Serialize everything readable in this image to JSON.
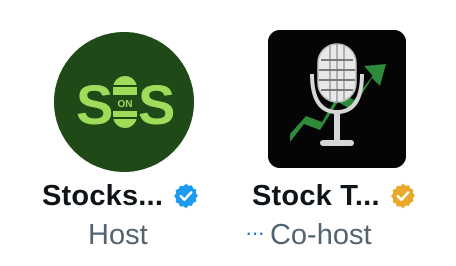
{
  "participants": [
    {
      "name": "Stocks...",
      "role": "Host",
      "verified": "blue",
      "badge_color": "#1d9bf0",
      "avatar": {
        "kind": "circle-logo",
        "logo_text_left": "S",
        "logo_text_right": "S",
        "logo_middle_text": "ON",
        "bg_color": "#1f4a17",
        "accent_color": "#9fdc5a"
      }
    },
    {
      "name": "Stock T...",
      "role": "Co-host",
      "more_icon": "ellipsis-icon",
      "more_glyph": "···",
      "verified": "gold",
      "badge_color": "#e8a92a",
      "avatar": {
        "kind": "square-microphone-chart",
        "bg_color": "#050505",
        "accent_color": "#2e8b3a"
      }
    }
  ]
}
